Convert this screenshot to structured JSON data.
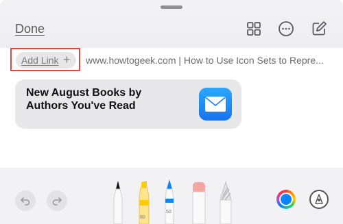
{
  "header": {
    "done_label": "Done",
    "icons": [
      "grid-icon",
      "more-icon",
      "compose-icon"
    ]
  },
  "link_bar": {
    "add_link_label": "Add Link",
    "add_link_plus": "+",
    "url_text": "www.howtogeek.com | How to Use Icon Sets to Repre..."
  },
  "note": {
    "title": "New August Books by Authors You've Read",
    "icon": "mail-app-icon"
  },
  "toolbar": {
    "undo_icon": "undo-icon",
    "redo_icon": "redo-icon",
    "tools": [
      {
        "name": "pen-tool",
        "label": ""
      },
      {
        "name": "highlighter-tool",
        "label": "80"
      },
      {
        "name": "pencil-tool",
        "label": "50"
      },
      {
        "name": "eraser-tool",
        "label": ""
      },
      {
        "name": "ruler-tool",
        "label": ""
      }
    ],
    "selected_color": "#0a84ff",
    "markup_icon": "pen-tip-icon"
  },
  "colors": {
    "highlight_box": "#e0483a",
    "accent": "#0a84ff"
  }
}
